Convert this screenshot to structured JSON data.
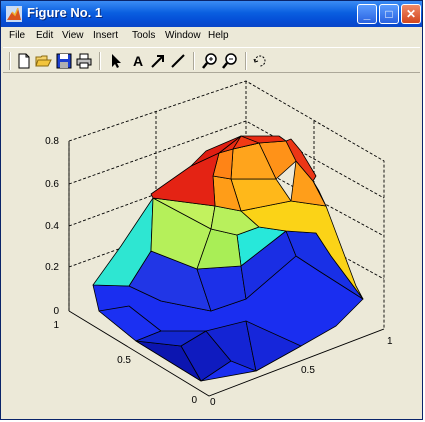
{
  "window": {
    "title": "Figure No. 1"
  },
  "title_buttons": {
    "minimize": "_",
    "maximize": "□",
    "close": "✕"
  },
  "menu": [
    {
      "label": "File"
    },
    {
      "label": "Edit"
    },
    {
      "label": "View"
    },
    {
      "label": "Insert"
    },
    {
      "label": "Tools"
    },
    {
      "label": "Window"
    },
    {
      "label": "Help"
    }
  ],
  "toolbar": [
    {
      "icon": "new-file-icon"
    },
    {
      "icon": "open-folder-icon"
    },
    {
      "icon": "save-icon"
    },
    {
      "icon": "print-icon"
    },
    {
      "icon": "select-arrow-icon"
    },
    {
      "icon": "insert-text-icon",
      "glyph": "A"
    },
    {
      "icon": "insert-arrow-icon"
    },
    {
      "icon": "insert-line-icon"
    },
    {
      "icon": "zoom-in-icon"
    },
    {
      "icon": "zoom-out-icon"
    },
    {
      "icon": "rotate-3d-icon"
    }
  ],
  "axes": {
    "z_ticks": [
      "0.8",
      "0.6",
      "0.4",
      "0.2",
      "0"
    ],
    "y_ticks": [
      "1",
      "0.5",
      "0"
    ],
    "x_ticks": [
      "0",
      "0.5",
      "1"
    ]
  },
  "chart_data": {
    "type": "surface",
    "colormap": "jet",
    "xlim": [
      0,
      1
    ],
    "ylim": [
      0,
      1
    ],
    "zlim": [
      0,
      0.8
    ],
    "grid": "on",
    "colors": {
      "high": "#e42314",
      "mid_high": "#fa9b16",
      "mid": "#b5f05a",
      "mid_low": "#2ee6d2",
      "low": "#1a36f0"
    }
  }
}
